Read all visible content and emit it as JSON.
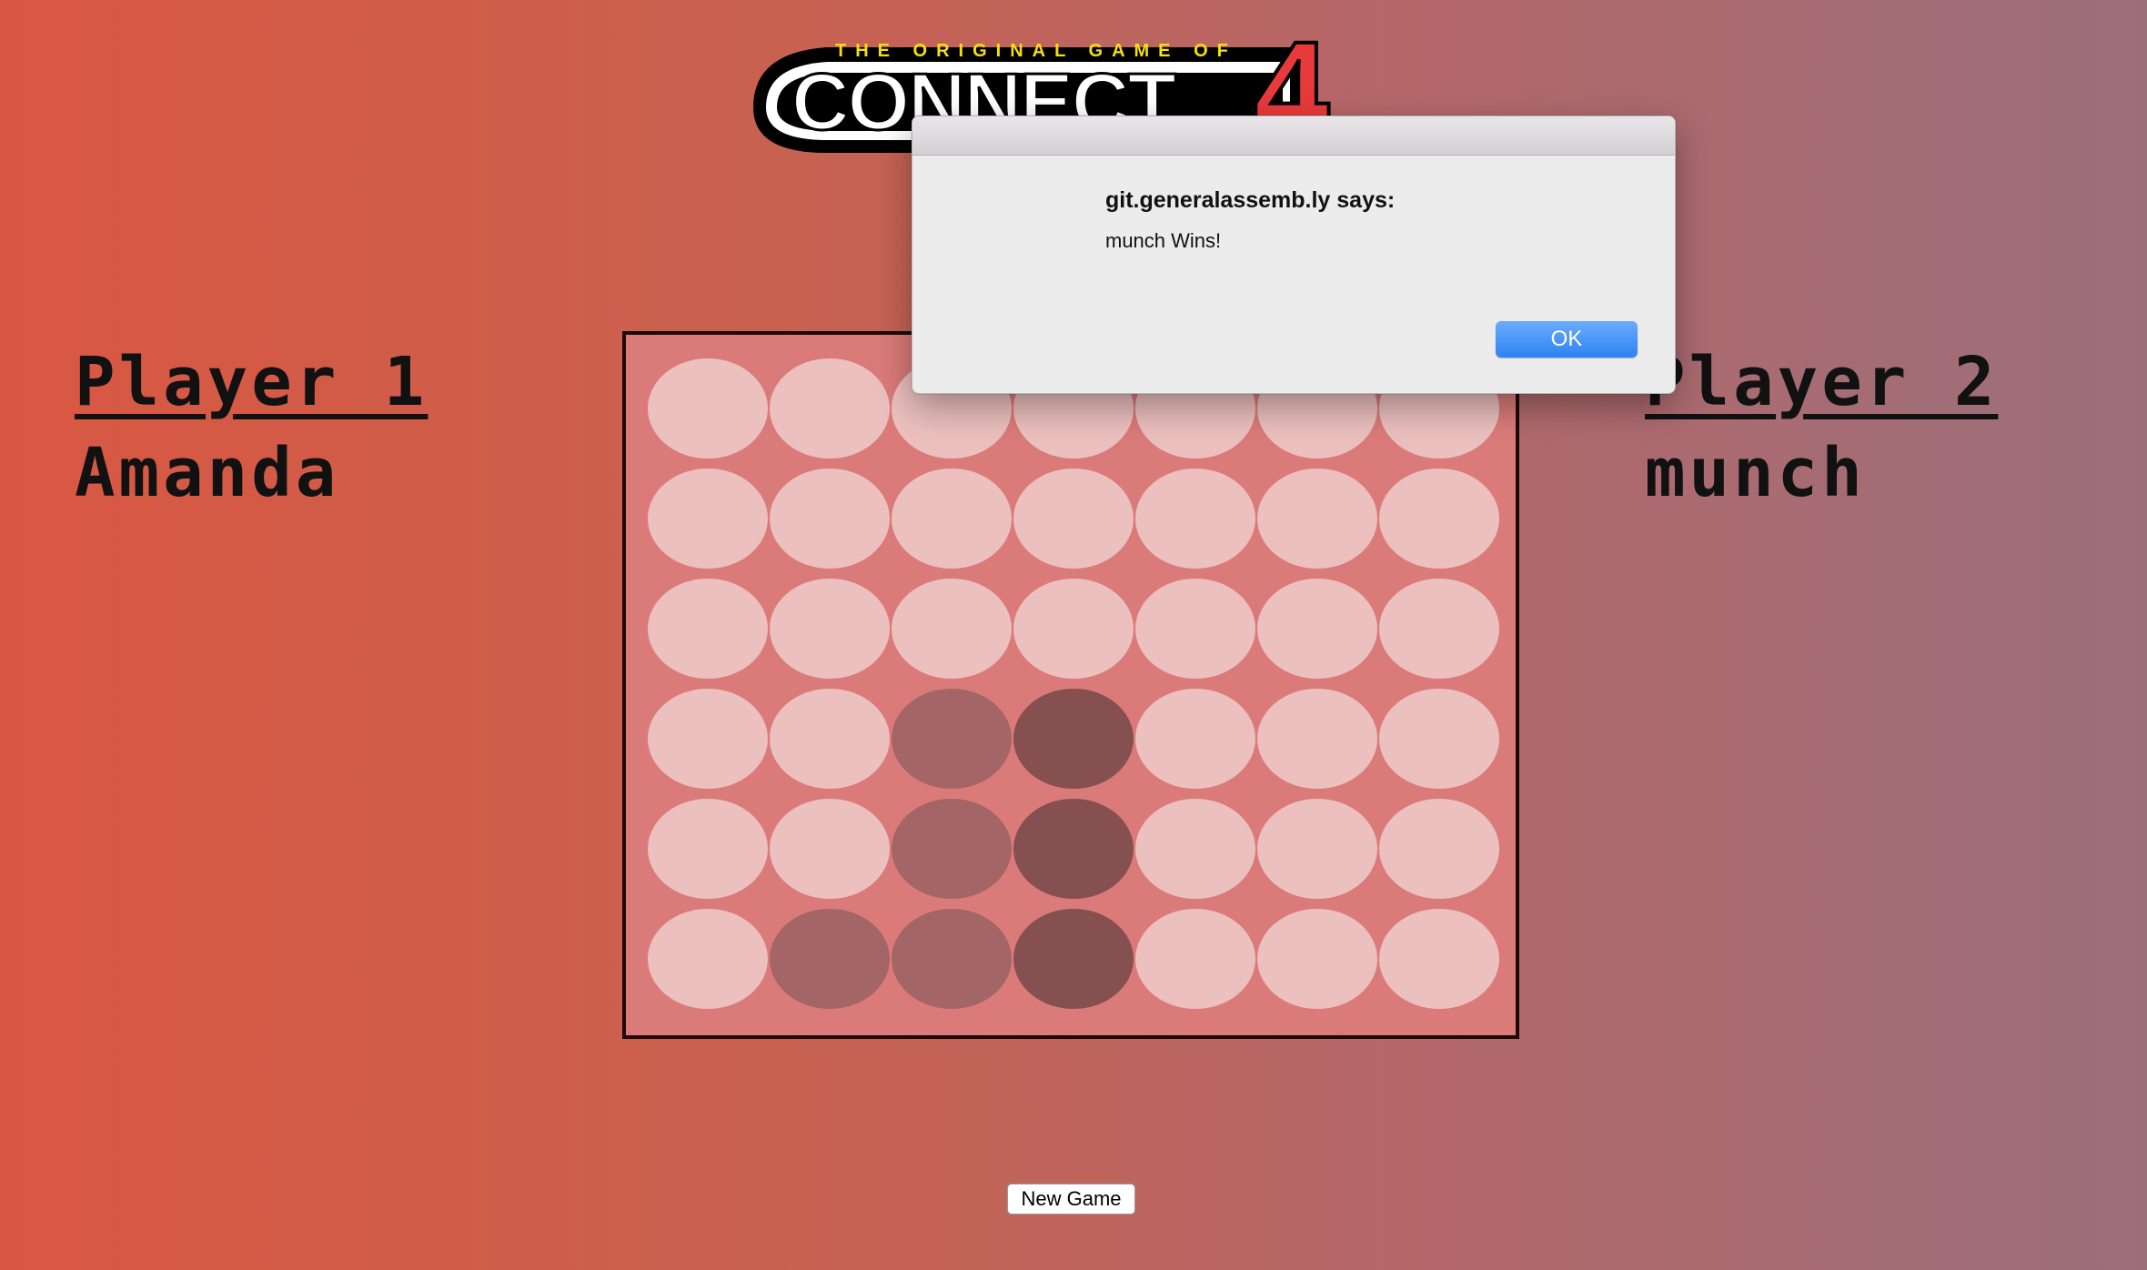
{
  "logo": {
    "tagline": "THE ORIGINAL GAME OF",
    "wordmark": "CONNECT",
    "digit": "4"
  },
  "players": {
    "p1": {
      "heading": "Player 1",
      "name": "Amanda"
    },
    "p2": {
      "heading": "Player 2",
      "name": "munch"
    }
  },
  "board": {
    "columns": 7,
    "rows": 6,
    "cells": [
      [
        0,
        0,
        0,
        0,
        0,
        0,
        0
      ],
      [
        0,
        0,
        0,
        0,
        0,
        0,
        0
      ],
      [
        0,
        0,
        0,
        0,
        0,
        0,
        0
      ],
      [
        0,
        0,
        1,
        2,
        0,
        0,
        0
      ],
      [
        0,
        0,
        1,
        2,
        0,
        0,
        0
      ],
      [
        0,
        1,
        1,
        2,
        0,
        0,
        0
      ]
    ],
    "colors": {
      "board": "#db7b79",
      "empty": "#ecc0bf",
      "player1": "#a46566",
      "player2": "#864f50"
    }
  },
  "controls": {
    "new_game_label": "New Game"
  },
  "dialog": {
    "title": "git.generalassemb.ly says:",
    "message": "munch Wins!",
    "ok_label": "OK"
  }
}
